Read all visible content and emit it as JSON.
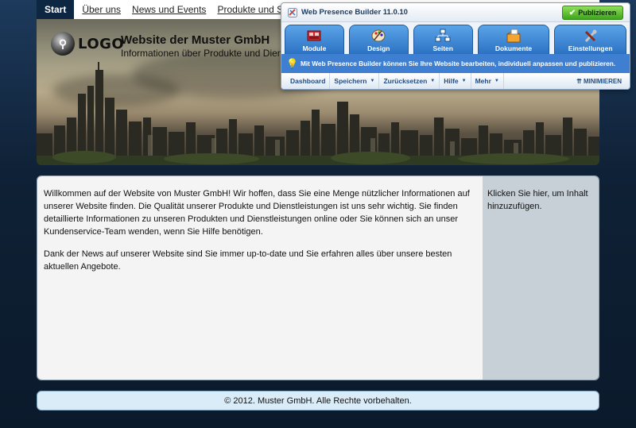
{
  "nav": {
    "items": [
      "Start",
      "Über uns",
      "News und Events",
      "Produkte und Services"
    ]
  },
  "header": {
    "logo_text": "LOGO",
    "title": "Website der Muster GmbH",
    "subtitle": "Informationen über Produkte und Dienst"
  },
  "content": {
    "paragraph1": "Willkommen auf der Website von Muster GmbH! Wir hoffen, dass Sie eine Menge nützlicher Informationen auf unserer Website finden. Die Qualität unserer Produkte und Dienstleistungen ist uns sehr wichtig. Sie finden detaillierte Informationen zu unseren Produkten und Dienstleistungen online oder Sie können sich an unser Kundenservice-Team wenden, wenn Sie Hilfe benötigen.",
    "paragraph2": "Dank der News auf unserer Website sind Sie immer up-to-date und Sie erfahren alles über unsere besten aktuellen Angebote.",
    "sidebar": "Klicken Sie hier, um Inhalt hinzuzufügen."
  },
  "footer": {
    "text": "© 2012. Muster GmbH. Alle Rechte vorbehalten."
  },
  "wpb": {
    "title": "Web Presence Builder 11.0.10",
    "publish_label": "Publizieren",
    "tabs": [
      {
        "label": "Module",
        "icon": "modules-icon"
      },
      {
        "label": "Design",
        "icon": "design-icon"
      },
      {
        "label": "Seiten",
        "icon": "pages-icon"
      },
      {
        "label": "Dokumente",
        "icon": "documents-icon"
      },
      {
        "label": "Einstellungen",
        "icon": "settings-icon"
      }
    ],
    "hint": "Mit Web Presence Builder können Sie Ihre Website bearbeiten, individuell anpassen und publizieren.",
    "toolbar": {
      "dashboard": "Dashboard",
      "save": "Speichern",
      "reset": "Zurücksetzen",
      "help": "Hilfe",
      "more": "Mehr",
      "minimize": "MINIMIEREN"
    },
    "colors": {
      "tab_blue": "#2c72c4",
      "publish_green": "#3fa51c",
      "hint_blue": "#3f7fd1"
    }
  }
}
